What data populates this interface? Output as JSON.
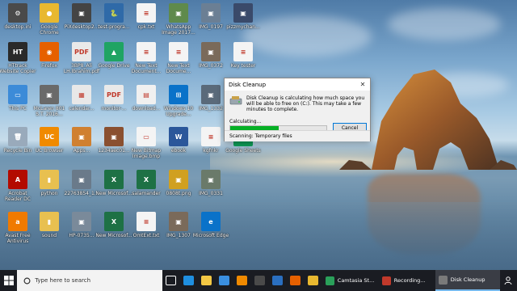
{
  "desktop": {
    "icons": [
      {
        "label": "desktop.ini",
        "color": "#4a4a4a",
        "glyph": "⚙"
      },
      {
        "label": "Google Chrome",
        "color": "#e8b830",
        "glyph": "●"
      },
      {
        "label": "PiXdesktop2...",
        "color": "#444444",
        "glyph": "▣"
      },
      {
        "label": "test-progra...",
        "color": "#2f6aa8",
        "glyph": "🐍"
      },
      {
        "label": "cpk.txt",
        "color": "#f4f4f4",
        "glyph": "≡"
      },
      {
        "label": "WhatsApp Image 2017...",
        "color": "#5f8a4c",
        "glyph": "▣"
      },
      {
        "label": "IMG_0197",
        "color": "#6b7f94",
        "glyph": "▣"
      },
      {
        "label": "pizzmychan...",
        "color": "#3a4a6a",
        "glyph": "▣"
      },
      {
        "label": "HTtrack Website Copier",
        "color": "#2a2a2a",
        "glyph": "HT"
      },
      {
        "label": "Firefox",
        "color": "#e66000",
        "glyph": "◉"
      },
      {
        "label": "3BP8_Ali LH.Ibrahim.pdf",
        "color": "#e9e9e9",
        "glyph": "PDF"
      },
      {
        "label": "Google Drive",
        "color": "#1fa463",
        "glyph": "▲"
      },
      {
        "label": "New Text Document...",
        "color": "#f4f4f4",
        "glyph": "≡"
      },
      {
        "label": "New Text Docume...",
        "color": "#f4f4f4",
        "glyph": "≡"
      },
      {
        "label": "IMG_0372",
        "color": "#7a6a5a",
        "glyph": "▣"
      },
      {
        "label": "Key tester",
        "color": "#f4f4f4",
        "glyph": "≡"
      },
      {
        "label": "This PC",
        "color": "#3c8bd8",
        "glyph": "▭"
      },
      {
        "label": "McLaren 801 S.T. 2016...",
        "color": "#6a6a6a",
        "glyph": "▣"
      },
      {
        "label": "calendar...",
        "color": "#e8e8e8",
        "glyph": "▦"
      },
      {
        "label": "monitor-...",
        "color": "#e9e9e9",
        "glyph": "PDF"
      },
      {
        "label": "download...",
        "color": "#f0f0f0",
        "glyph": "▤"
      },
      {
        "label": "Windows 10 Upgrade...",
        "color": "#0a72c9",
        "glyph": "⊞"
      },
      {
        "label": "IMG_1332",
        "color": "#5a6a7a",
        "glyph": "▣"
      },
      {
        "label": "Recycle Bin",
        "color": "#9ab",
        "glyph": "🗑"
      },
      {
        "label": "UC Browser",
        "color": "#f08a00",
        "glyph": "UC"
      },
      {
        "label": "Apps...",
        "color": "#d08030",
        "glyph": "▣"
      },
      {
        "label": "1234aec01...",
        "color": "#8a5030",
        "glyph": "▣"
      },
      {
        "label": "New Bitmap Image.bmp",
        "color": "#f4f4f4",
        "glyph": "▭"
      },
      {
        "label": "ebook",
        "color": "#2b579a",
        "glyph": "W"
      },
      {
        "label": "kgfnkr",
        "color": "#f4f4f4",
        "glyph": "≡"
      },
      {
        "label": "Google Sheets",
        "color": "#0f9d58",
        "glyph": "▦"
      },
      {
        "label": "Acrobat Reader DC",
        "color": "#b30b00",
        "glyph": "A"
      },
      {
        "label": "python",
        "color": "#e8c050",
        "glyph": "▮"
      },
      {
        "label": "22763854_1...",
        "color": "#6a7a8a",
        "glyph": "▣"
      },
      {
        "label": "New Microsof...",
        "color": "#1e7145",
        "glyph": "X"
      },
      {
        "label": "salamander",
        "color": "#1e7145",
        "glyph": "X"
      },
      {
        "label": "0808t.png",
        "color": "#d0a020",
        "glyph": "▣"
      },
      {
        "label": "IMG_0331",
        "color": "#6a7a6a",
        "glyph": "▣"
      },
      {
        "label": "Avast Free Antivirus",
        "color": "#f07a00",
        "glyph": "a"
      },
      {
        "label": "sound",
        "color": "#e8c050",
        "glyph": "▮"
      },
      {
        "label": "HP-0735...",
        "color": "#7a8a9a",
        "glyph": "▣"
      },
      {
        "label": "New Microsof...",
        "color": "#1e7145",
        "glyph": "X"
      },
      {
        "label": "OmtExt.txt",
        "color": "#f4f4f4",
        "glyph": "≡"
      },
      {
        "label": "IMG_1307",
        "color": "#7a6a5a",
        "glyph": "▣"
      },
      {
        "label": "Microsoft Edge",
        "color": "#0a72c9",
        "glyph": "e"
      }
    ]
  },
  "dialog": {
    "title": "Disk Cleanup",
    "message": "Disk Cleanup is calculating how much space you will be able to free on  (C:). This may take a few minutes to complete.",
    "calculating_label": "Calculating...",
    "progress": 0.5,
    "cancel_label": "Cancel",
    "status_text": "Scanning:   Temporary files",
    "close_glyph": "✕"
  },
  "taskbar": {
    "search_placeholder": "Type here to search",
    "pinned": [
      {
        "name": "task-view",
        "color": "#ffffff"
      },
      {
        "name": "edge",
        "color": "#1f8fe0"
      },
      {
        "name": "file-explorer",
        "color": "#f2c744"
      },
      {
        "name": "store",
        "color": "#3a8fe0"
      },
      {
        "name": "vlc",
        "color": "#f08a00"
      },
      {
        "name": "app-dark",
        "color": "#4a4a4a"
      },
      {
        "name": "app-blue",
        "color": "#2a6fc0"
      },
      {
        "name": "firefox",
        "color": "#e66000"
      },
      {
        "name": "chrome",
        "color": "#e8b830"
      }
    ],
    "windows": [
      {
        "label": "Camtasia St...",
        "color": "#2aa05a"
      },
      {
        "label": "Recording...",
        "color": "#c0392b"
      },
      {
        "label": "Disk Cleanup",
        "color": "#7a7a7a"
      }
    ]
  }
}
